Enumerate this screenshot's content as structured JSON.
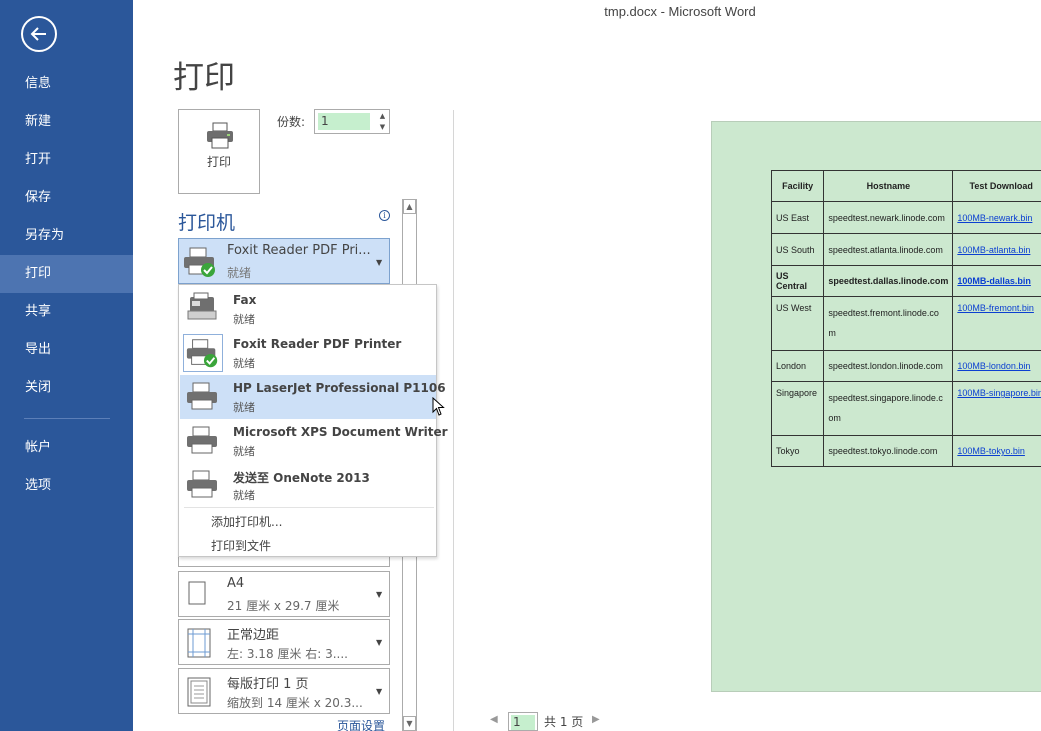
{
  "window": {
    "title": "tmp.docx - Microsoft Word"
  },
  "sidebar": {
    "items": [
      {
        "label": "信息"
      },
      {
        "label": "新建"
      },
      {
        "label": "打开"
      },
      {
        "label": "保存"
      },
      {
        "label": "另存为"
      },
      {
        "label": "打印"
      },
      {
        "label": "共享"
      },
      {
        "label": "导出"
      },
      {
        "label": "关闭"
      },
      {
        "label": "帐户"
      },
      {
        "label": "选项"
      }
    ],
    "active": "打印"
  },
  "print": {
    "title": "打印",
    "button_label": "打印",
    "copies_label": "份数:",
    "copies_value": "1"
  },
  "printer": {
    "heading": "打印机",
    "selected": {
      "name": "Foxit Reader PDF Pri...",
      "status": "就绪"
    },
    "options": [
      {
        "name": "Fax",
        "status": "就绪"
      },
      {
        "name": "Foxit Reader PDF Printer",
        "status": "就绪"
      },
      {
        "name": "HP LaserJet Professional P1106",
        "status": "就绪"
      },
      {
        "name": "Microsoft XPS Document Writer",
        "status": "就绪"
      },
      {
        "name": "发送至 OneNote 2013",
        "status": "就绪"
      }
    ],
    "add_printer": "添加打印机...",
    "print_to_file": "打印到文件"
  },
  "settings": {
    "paper": {
      "main": "A4",
      "sub": "21 厘米 x 29.7 厘米"
    },
    "margins": {
      "main": "正常边距",
      "sub": "左: 3.18 厘米   右: 3...."
    },
    "pages_per_sheet": {
      "main": "每版打印 1 页",
      "sub": "缩放到 14 厘米 x 20.3..."
    },
    "page_setup_link": "页面设置"
  },
  "preview": {
    "headers": [
      "Facility",
      "Hostname",
      "Test Download"
    ],
    "rows": [
      [
        "US East",
        "speedtest.newark.linode.com",
        "100MB-newark.bin"
      ],
      [
        "US South",
        "speedtest.atlanta.linode.com",
        "100MB-atlanta.bin"
      ],
      [
        "US Central",
        "speedtest.dallas.linode.com",
        "100MB-dallas.bin"
      ],
      [
        "US West",
        "speedtest.fremont.linode.co\nm",
        "100MB-fremont.bin"
      ],
      [
        "London",
        "speedtest.london.linode.com",
        "100MB-london.bin"
      ],
      [
        "Singapore",
        "speedtest.singapore.linode.c\nom",
        "100MB-singapore.bin"
      ],
      [
        "Tokyo",
        "speedtest.tokyo.linode.com",
        "100MB-tokyo.bin"
      ]
    ],
    "page_current": "1",
    "page_total": "共 1 页"
  }
}
